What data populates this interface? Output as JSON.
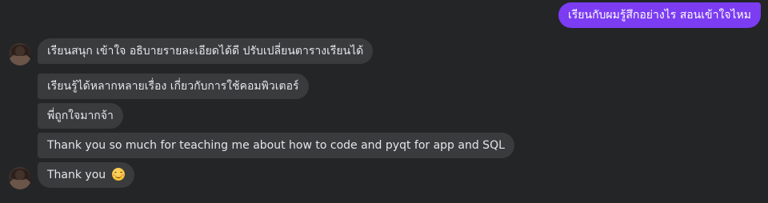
{
  "conversation": {
    "outgoing_messages": [
      {
        "text": "เรียนกับผมรู้สึกอย่างไร สอนเข้าใจไหม"
      }
    ],
    "incoming_messages": [
      {
        "text": "เรียนสนุก เข้าใจ อธิบายรายละเอียดได้ดี ปรับเปลี่ยนตารางเรียนได้"
      },
      {
        "text": "เรียนรู้ได้หลากหลายเรื่อง เกี่ยวกับการใช้คอมพิวเตอร์"
      },
      {
        "text": "พี่ถูกใจมากจ้า"
      },
      {
        "text": "Thank you so much for teaching me about how to code and pyqt for app and SQL"
      },
      {
        "text": "Thank you",
        "emoji": "smiling-face-with-smiling-eyes"
      }
    ],
    "contact_avatar": "avatar-icon"
  },
  "colors": {
    "background": "#242526",
    "outgoing_bubble": "#7b3cf2",
    "incoming_bubble": "#3a3b3c",
    "text": "#e4e6eb"
  }
}
